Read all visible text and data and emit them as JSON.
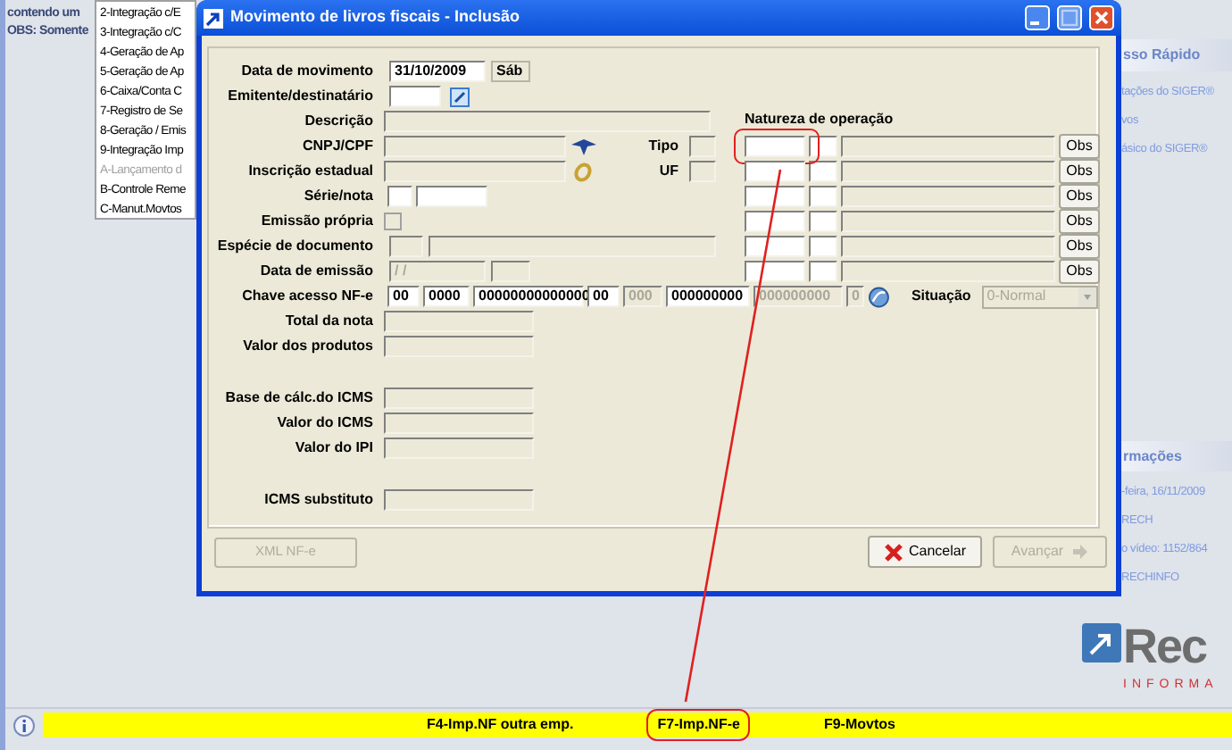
{
  "desktop": {
    "notes": [
      "contendo um",
      "OBS: Somente"
    ],
    "menu": [
      {
        "label": "2-Integração c/E",
        "disabled": false
      },
      {
        "label": "3-Integração c/C",
        "disabled": false
      },
      {
        "label": "4-Geração de Ap",
        "disabled": false
      },
      {
        "label": "5-Geração de Ap",
        "disabled": false
      },
      {
        "label": "6-Caixa/Conta C",
        "disabled": false
      },
      {
        "label": "7-Registro de Se",
        "disabled": false
      },
      {
        "label": "8-Geração / Emis",
        "disabled": false
      },
      {
        "label": "9-Integração Imp",
        "disabled": false
      },
      {
        "label": "A-Lançamento d",
        "disabled": true
      },
      {
        "label": "B-Controle Reme",
        "disabled": false
      },
      {
        "label": "C-Manut.Movtos",
        "disabled": false
      }
    ],
    "quick_access": {
      "title": "sso Rápido",
      "items": [
        "tações do SIGER®",
        "vos",
        "ásico do SIGER®"
      ]
    },
    "info": {
      "title": "rmações",
      "items": [
        "-feira, 16/11/2009",
        "RECH",
        "o vídeo: 1152/864",
        "RECHINFO"
      ]
    },
    "logo": {
      "text": "Rec",
      "subtext": "INFORMA"
    }
  },
  "dialog": {
    "title": "Movimento de livros fiscais - Inclusão",
    "data_movimento": {
      "label": "Data de movimento",
      "value": "31/10/2009",
      "weekday": "Sáb"
    },
    "emitente": {
      "label": "Emitente/destinatário",
      "disabled": false
    },
    "descricao": {
      "label": "Descrição",
      "disabled": true
    },
    "cnpj": {
      "label": "CNPJ/CPF",
      "disabled": true
    },
    "tipo": {
      "label": "Tipo",
      "disabled": true
    },
    "inscricao": {
      "label": "Inscrição estadual",
      "disabled": true
    },
    "uf": {
      "label": "UF",
      "disabled": true
    },
    "serie_nota": {
      "label": "Série/nota",
      "disabled": false
    },
    "emissao_propria": {
      "label": "Emissão própria",
      "checked": false,
      "disabled": true
    },
    "especie": {
      "label": "Espécie de documento",
      "disabled": true
    },
    "data_emissao": {
      "label": "Data de emissão",
      "value": "/ /",
      "disabled": true
    },
    "chave": {
      "label": "Chave acesso NF-e",
      "parts": [
        {
          "value": "00",
          "disabled": false
        },
        {
          "value": "0000",
          "disabled": false
        },
        {
          "value": "00000000000000",
          "disabled": false
        },
        {
          "value": "00",
          "disabled": false
        },
        {
          "value": "000",
          "disabled": true
        },
        {
          "value": "000000000",
          "disabled": false
        },
        {
          "value": "000000000",
          "disabled": true
        },
        {
          "value": "0",
          "disabled": true
        }
      ]
    },
    "situacao": {
      "label": "Situação",
      "value": "0-Normal",
      "disabled": true
    },
    "natureza": {
      "label": "Natureza de operação",
      "rows": [
        {
          "button": "Obs",
          "highlighted": true
        },
        {
          "button": "Obs",
          "highlighted": false
        },
        {
          "button": "Obs",
          "highlighted": false
        },
        {
          "button": "Obs",
          "highlighted": false
        },
        {
          "button": "Obs",
          "highlighted": false
        },
        {
          "button": "Obs",
          "highlighted": false
        }
      ]
    },
    "totals": [
      [
        {
          "label": "Total da nota"
        },
        {
          "label": "Valor dos produtos"
        }
      ],
      [
        {
          "label": "Base de cálc.do ICMS"
        },
        {
          "label": "Valor do ICMS"
        },
        {
          "label": "Valor do IPI"
        }
      ],
      [
        {
          "label": "ICMS substituto"
        }
      ]
    ],
    "xml_button": {
      "label": "XML NF-e",
      "disabled": true
    },
    "cancel_button": {
      "label": "Cancelar",
      "disabled": false
    },
    "next_button": {
      "label": "Avançar",
      "disabled": true
    }
  },
  "status_bar": {
    "items": [
      {
        "label": "F4-Imp.NF outra emp.",
        "highlighted": false
      },
      {
        "label": "F7-Imp.NF-e",
        "highlighted": true
      },
      {
        "label": "F9-Movtos",
        "highlighted": false
      }
    ]
  }
}
